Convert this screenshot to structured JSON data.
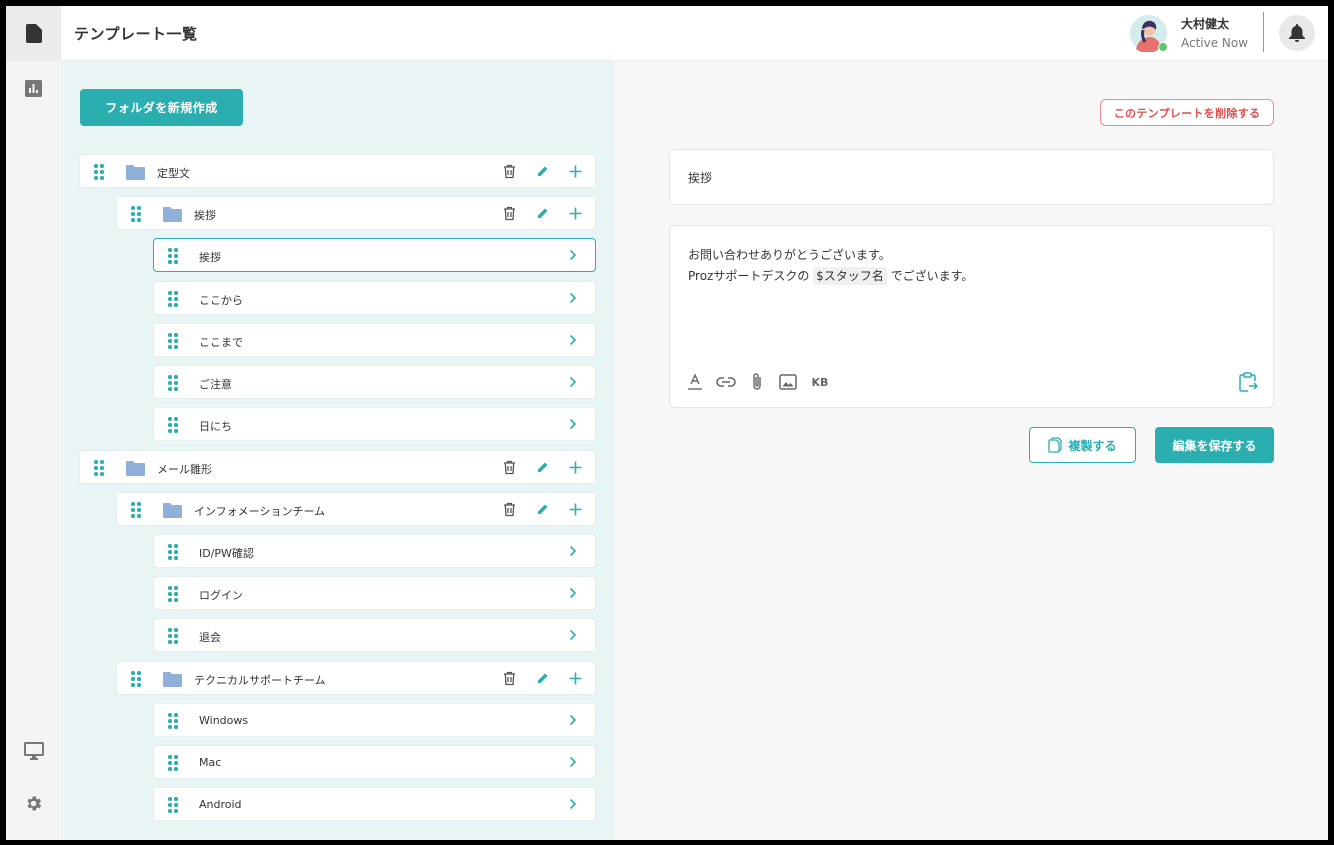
{
  "header": {
    "title": "テンプレート一覧",
    "user_name": "大村健太",
    "user_status": "Active Now"
  },
  "rail": {
    "icons": [
      "document-icon",
      "bar-chart-icon",
      "monitor-icon",
      "gear-icon"
    ]
  },
  "tree": {
    "new_folder_label": "フォルダを新規作成",
    "folder_color": "#8fb0d8",
    "accent_color": "#2aaeb0",
    "rows": [
      {
        "kind": "folder",
        "level": 0,
        "label": "定型文"
      },
      {
        "kind": "folder",
        "level": 1,
        "label": "挨拶"
      },
      {
        "kind": "item",
        "label": "挨拶",
        "selected": true
      },
      {
        "kind": "item",
        "label": "ここから"
      },
      {
        "kind": "item",
        "label": "ここまで"
      },
      {
        "kind": "item",
        "label": "ご注意"
      },
      {
        "kind": "item",
        "label": "日にち"
      },
      {
        "kind": "folder",
        "level": 0,
        "label": "メール雛形"
      },
      {
        "kind": "folder",
        "level": 1,
        "label": "インフォメーションチーム"
      },
      {
        "kind": "item",
        "label": "ID/PW確認"
      },
      {
        "kind": "item",
        "label": "ログイン"
      },
      {
        "kind": "item",
        "label": "退会"
      },
      {
        "kind": "folder",
        "level": 1,
        "label": "テクニカルサポートチーム"
      },
      {
        "kind": "item",
        "label": "Windows"
      },
      {
        "kind": "item",
        "label": "Mac"
      },
      {
        "kind": "item",
        "label": "Android"
      }
    ]
  },
  "editor": {
    "delete_label": "このテンプレートを削除する",
    "delete_color": "#e44b4b",
    "title_value": "挨拶",
    "body_line1": "お問い合わせありがとうございます。",
    "body_line2_prefix": "Prozサポートデスクの ",
    "body_variable": "$スタッフ名",
    "body_line2_suffix": " でございます。",
    "toolbar": {
      "kb_label": "KB"
    },
    "copy_label": "複製する",
    "save_label": "編集を保存する"
  }
}
